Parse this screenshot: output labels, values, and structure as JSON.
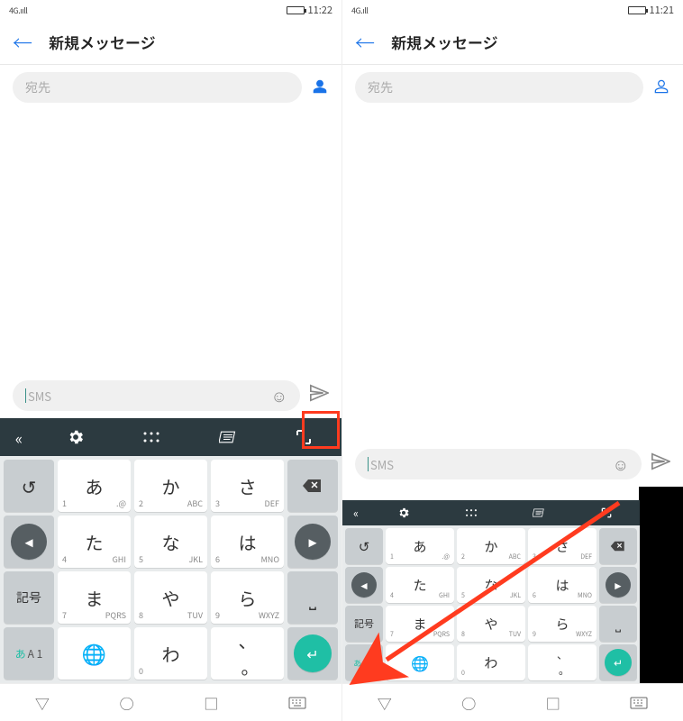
{
  "left": {
    "status": {
      "network": "4G.ııll",
      "time": "11:22"
    },
    "header": {
      "title": "新規メッセージ"
    },
    "recipient": {
      "placeholder": "宛先"
    },
    "compose": {
      "placeholder": "SMS"
    }
  },
  "right": {
    "status": {
      "network": "4G.ıll",
      "time": "11:21"
    },
    "header": {
      "title": "新規メッセージ"
    },
    "recipient": {
      "placeholder": "宛先"
    },
    "compose": {
      "placeholder": "SMS"
    }
  },
  "keyboard": {
    "mode_label_active": "あ",
    "mode_label_rest": "A 1",
    "symbol_label": "記号",
    "rows": [
      [
        {
          "main": "あ",
          "subl": "1",
          "sub": ".@"
        },
        {
          "main": "か",
          "subl": "2",
          "sub": "ABC"
        },
        {
          "main": "さ",
          "subl": "3",
          "sub": "DEF"
        }
      ],
      [
        {
          "main": "た",
          "subl": "4",
          "sub": "GHI"
        },
        {
          "main": "な",
          "subl": "5",
          "sub": "JKL"
        },
        {
          "main": "は",
          "subl": "6",
          "sub": "MNO"
        }
      ],
      [
        {
          "main": "ま",
          "subl": "7",
          "sub": "PQRS"
        },
        {
          "main": "や",
          "subl": "8",
          "sub": "TUV"
        },
        {
          "main": "ら",
          "subl": "9",
          "sub": "WXYZ"
        }
      ],
      [
        {
          "main": "⊕",
          "subl": "",
          "sub": ""
        },
        {
          "main": "わ",
          "subl": "0",
          "sub": ""
        },
        {
          "main": "、。",
          "subl": "",
          "sub": ""
        }
      ]
    ]
  }
}
